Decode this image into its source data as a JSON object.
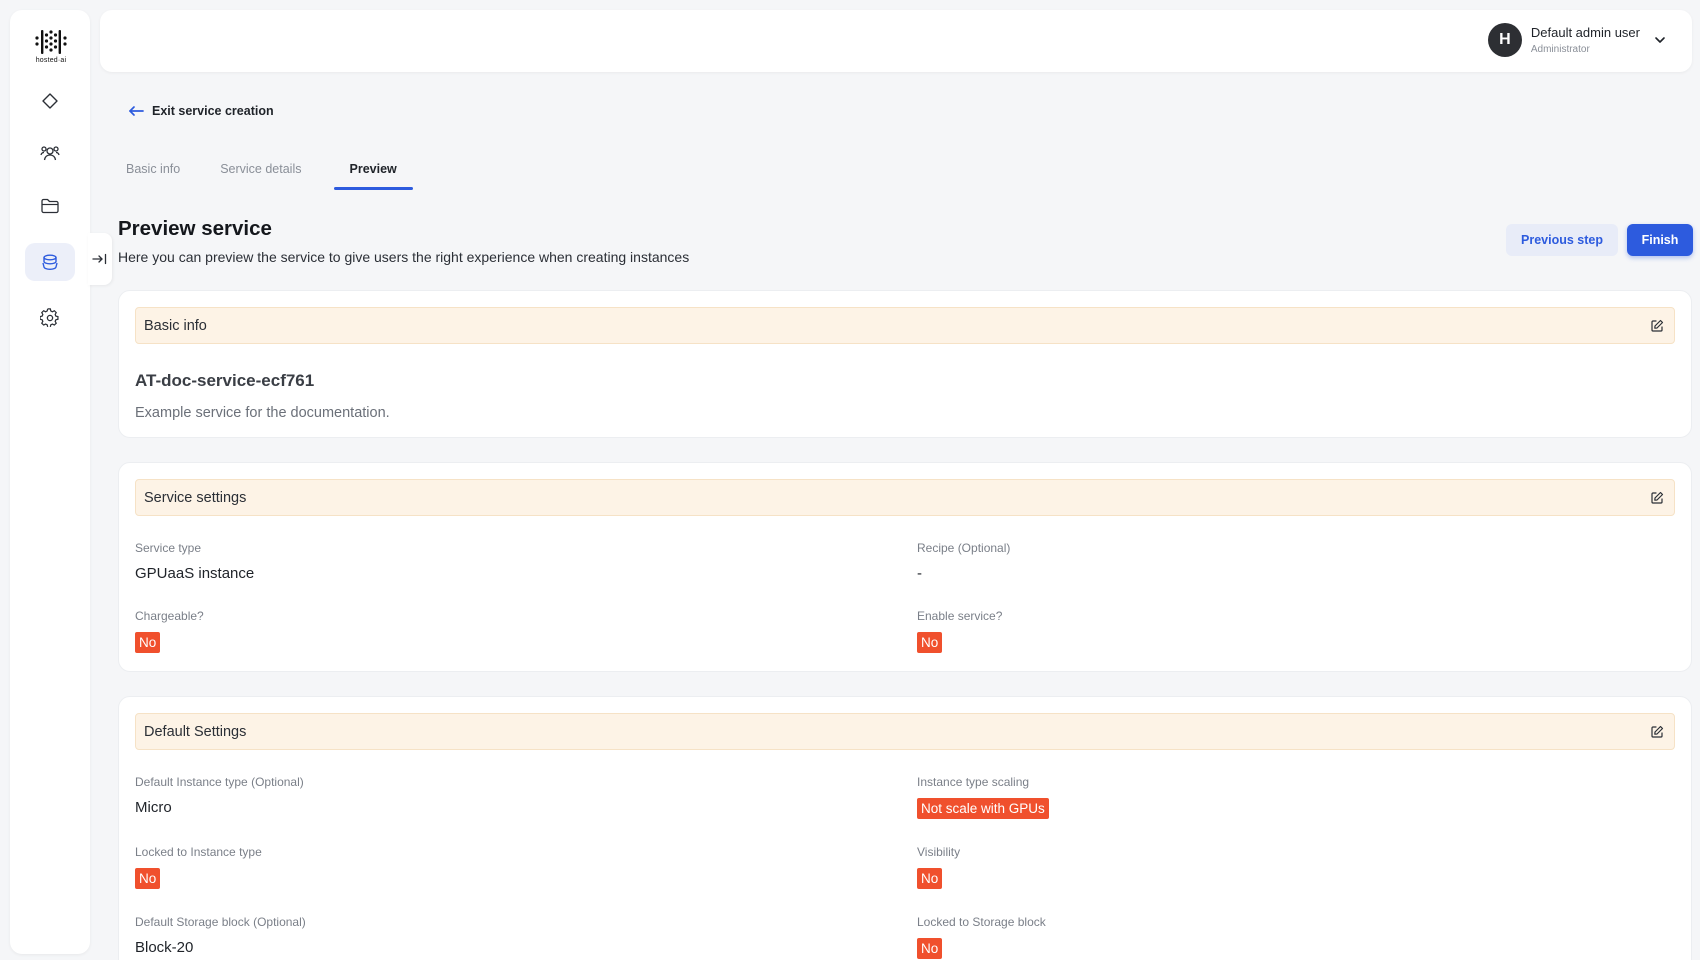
{
  "brand": {
    "logo_text": "hosted·ai"
  },
  "sidebar": {
    "items": [
      {
        "name": "dashboard",
        "icon": "diamond-icon"
      },
      {
        "name": "users",
        "icon": "users-icon"
      },
      {
        "name": "files",
        "icon": "folder-icon"
      },
      {
        "name": "services",
        "icon": "stack-icon",
        "active": true
      },
      {
        "name": "settings",
        "icon": "gear-icon"
      }
    ]
  },
  "header": {
    "user": {
      "initial": "H",
      "name": "Default admin user",
      "role": "Administrator"
    }
  },
  "back_link": {
    "label": "Exit service creation"
  },
  "tabs": [
    {
      "label": "Basic info",
      "active": false
    },
    {
      "label": "Service details",
      "active": false
    },
    {
      "label": "Preview",
      "active": true
    }
  ],
  "page": {
    "title": "Preview service",
    "subtitle": "Here you can preview the service to give users the right experience when creating instances"
  },
  "actions": {
    "previous_label": "Previous step",
    "finish_label": "Finish"
  },
  "basic_info": {
    "title": "Basic info",
    "service_name": "AT-doc-service-ecf761",
    "description": "Example service for the documentation."
  },
  "service_settings": {
    "title": "Service settings",
    "service_type_label": "Service type",
    "service_type_value": "GPUaaS instance",
    "recipe_label": "Recipe (Optional)",
    "recipe_value": "-",
    "chargeable_label": "Chargeable?",
    "chargeable_value": "No",
    "enable_label": "Enable service?",
    "enable_value": "No"
  },
  "default_settings": {
    "title": "Default Settings",
    "instance_type_label": "Default Instance type (Optional)",
    "instance_type_value": "Micro",
    "scaling_label": "Instance type scaling",
    "scaling_value": "Not scale with GPUs",
    "locked_instance_label": "Locked to Instance type",
    "locked_instance_value": "No",
    "visibility_label": "Visibility",
    "visibility_value": "No",
    "storage_label": "Default Storage block (Optional)",
    "storage_value": "Block-20",
    "locked_storage_label": "Locked to Storage block",
    "locked_storage_value": "No"
  },
  "colors": {
    "accent": "#2d5bde",
    "badge_red": "#f0502d",
    "section_header_bg": "#fdf3e6"
  }
}
